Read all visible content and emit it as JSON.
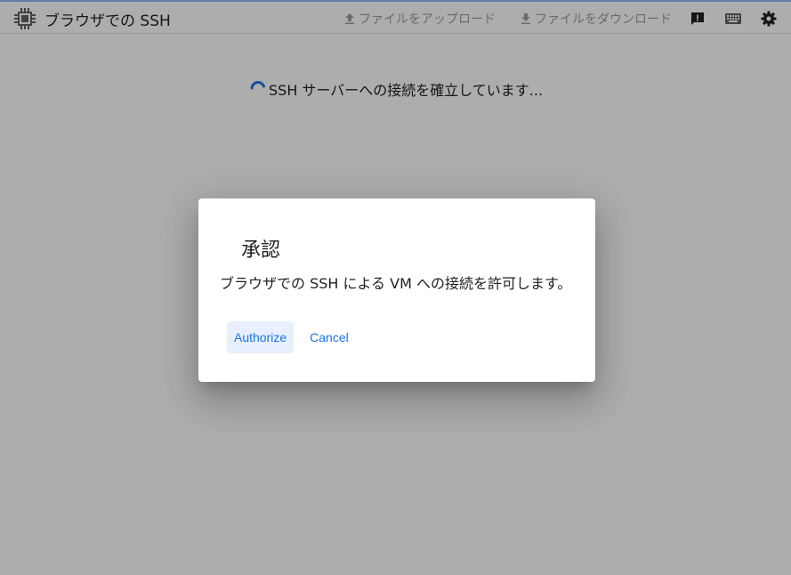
{
  "app": {
    "title": "ブラウザでの SSH"
  },
  "toolbar": {
    "upload_label": "ファイルをアップロード",
    "download_label": "ファイルをダウンロード",
    "feedback_icon": "feedback-icon",
    "keyboard_icon": "keyboard-icon",
    "settings_icon": "gear-icon"
  },
  "status": {
    "message": "SSH サーバーへの接続を確立しています..."
  },
  "dialog": {
    "title": "承認",
    "body": "ブラウザでの SSH による VM への接続を許可します。",
    "authorize_label": "Authorize",
    "cancel_label": "Cancel"
  },
  "colors": {
    "accent": "#1a73e8",
    "overlay": "#000000",
    "toolbar_muted": "#9aa0a6"
  }
}
